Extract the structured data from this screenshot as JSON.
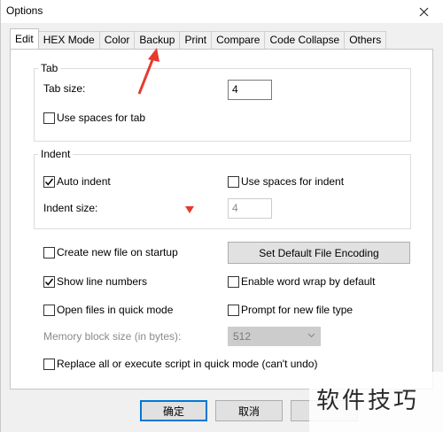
{
  "window": {
    "title": "Options"
  },
  "tabs": [
    "Edit",
    "HEX Mode",
    "Color",
    "Backup",
    "Print",
    "Compare",
    "Code Collapse",
    "Others"
  ],
  "tab_group": {
    "legend": "Tab",
    "tab_size_label": "Tab size:",
    "tab_size_value": "4",
    "use_spaces_label": "Use spaces for tab",
    "use_spaces_checked": false
  },
  "indent_group": {
    "legend": "Indent",
    "auto_indent_label": "Auto indent",
    "auto_indent_checked": true,
    "use_spaces_label": "Use spaces for indent",
    "use_spaces_checked": false,
    "indent_size_label": "Indent size:",
    "indent_size_value": "4"
  },
  "options": {
    "create_new_file_label": "Create new file on startup",
    "create_new_file_checked": false,
    "set_encoding_button": "Set Default File Encoding",
    "show_line_numbers_label": "Show line numbers",
    "show_line_numbers_checked": true,
    "word_wrap_label": "Enable word wrap by default",
    "word_wrap_checked": false,
    "open_quick_mode_label": "Open files in quick mode",
    "open_quick_mode_checked": false,
    "prompt_file_type_label": "Prompt for new file type",
    "prompt_file_type_checked": false,
    "memory_block_label": "Memory block size (in bytes):",
    "memory_block_value": "512",
    "replace_all_label": "Replace all or execute script in quick mode (can't undo)",
    "replace_all_checked": false
  },
  "footer": {
    "ok_label": "确定",
    "cancel_label": "取消"
  },
  "watermark": {
    "text": "软件技巧"
  },
  "icons": {
    "close": "close-icon",
    "checkmark": "checkmark-icon",
    "dropdown": "chevron-down-icon"
  },
  "colors": {
    "accent": "#0078d7",
    "annotation_red": "#e63a2e"
  }
}
